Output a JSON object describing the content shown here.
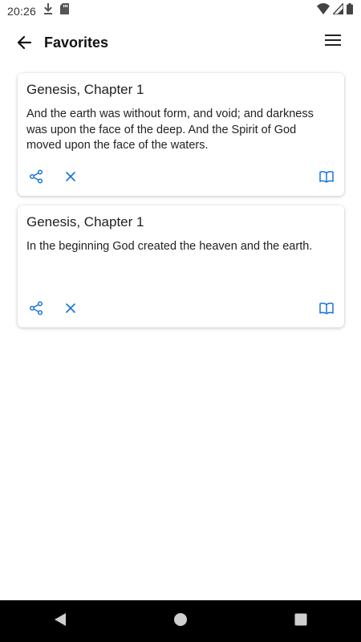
{
  "status_bar": {
    "time": "20:26",
    "icons": [
      "download-icon",
      "sd-card-icon",
      "wifi-icon",
      "signal-icon",
      "battery-icon"
    ]
  },
  "app_bar": {
    "title": "Favorites",
    "icons": [
      "back-arrow-icon",
      "menu-icon"
    ]
  },
  "favorites": [
    {
      "title": "Genesis, Chapter 1",
      "text": "And the earth was without form, and void; and darkness was upon the face of the deep. And the Spirit of God moved upon the face of the waters.",
      "actions": [
        "share-icon",
        "close-icon",
        "book-icon"
      ]
    },
    {
      "title": "Genesis, Chapter 1",
      "text": "In the beginning God created the heaven and the earth.",
      "actions": [
        "share-icon",
        "close-icon",
        "book-icon"
      ]
    }
  ],
  "nav_bar": {
    "buttons": [
      "back-triangle-icon",
      "home-circle-icon",
      "recents-square-icon"
    ]
  },
  "colors": {
    "accent": "#1a73d9",
    "nav_background": "#000000",
    "text": "#222222"
  }
}
